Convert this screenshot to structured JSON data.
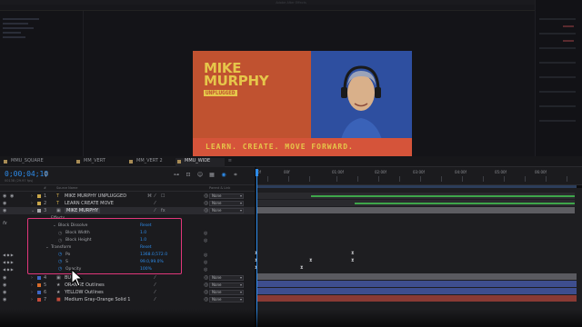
{
  "app": {
    "window_title": "Adobe After Effects"
  },
  "video": {
    "title_line1": "MIKE",
    "title_line2": "MURPHY",
    "subtitle": "UNPLUGGED",
    "tagline": "LEARN. CREATE. MOVE FORWARD."
  },
  "timeline_tabs": [
    {
      "label": "MMU_SQUARE",
      "active": false
    },
    {
      "label": "MM_VERT",
      "active": false
    },
    {
      "label": "MM_VERT 2",
      "active": false
    },
    {
      "label": "MMU_WIDE",
      "active": true
    }
  ],
  "header": {
    "timecode": "0;00;04;18",
    "frame_info": "00138 (29.97 fps)",
    "search_placeholder": ""
  },
  "columns": {
    "source_name": "Source Name",
    "parent_link": "Parent & Link",
    "num": "#"
  },
  "ruler_labels": [
    "0f",
    "00f",
    "01:00f",
    "02:00f",
    "03:00f",
    "04:00f",
    "05:00f",
    "06:00f"
  ],
  "layers": [
    {
      "num": "1",
      "type": "T",
      "name": "MIKE MURPHY UNPLUGGED",
      "color": "#c9a64a",
      "parent": "None"
    },
    {
      "num": "2",
      "type": "T",
      "name": "LEARN CREATE MOVE",
      "color": "#c9a64a",
      "parent": "None"
    },
    {
      "num": "3",
      "type": "▣",
      "name": "MIKE MURPHY",
      "color": "#a8a8ac",
      "parent": "None",
      "selected": true
    },
    {
      "num": "4",
      "type": "▣",
      "name": "BUG",
      "color": "#3e66c4",
      "parent": "None"
    },
    {
      "num": "5",
      "type": "★",
      "name": "ORANGE Outlines",
      "color": "#d96c2a",
      "parent": "None"
    },
    {
      "num": "6",
      "type": "★",
      "name": "YELLOW Outlines",
      "color": "#3e66c4",
      "parent": "None"
    },
    {
      "num": "7",
      "type": "■",
      "name": "Medium Gray-Orange Solid 1",
      "color": "#c44a3a",
      "parent": "None"
    }
  ],
  "properties": {
    "fx_label": "fx",
    "effects_label": "Effects",
    "block_dissolve_label": "Block Dissolve",
    "block_dissolve_reset": "Reset",
    "block_width_label": "Block Width",
    "block_width_value": "1.0",
    "block_height_label": "Block Height",
    "block_height_value": "1.0",
    "transform_label": "Transform",
    "transform_reset": "Reset",
    "position_label": "Po",
    "position_value": "1368.0,572.0",
    "scale_label": "S",
    "scale_value": "99.0,99.0%",
    "opacity_label": "Opacity",
    "opacity_value": "100%"
  },
  "colors": {
    "accent": "#2d8ceb",
    "highlight": "#e0377a",
    "track_gray": "#5d5d62",
    "track_blue": "#3e4e8e",
    "track_red": "#8a3a34",
    "track_green": "#3ea64a"
  }
}
